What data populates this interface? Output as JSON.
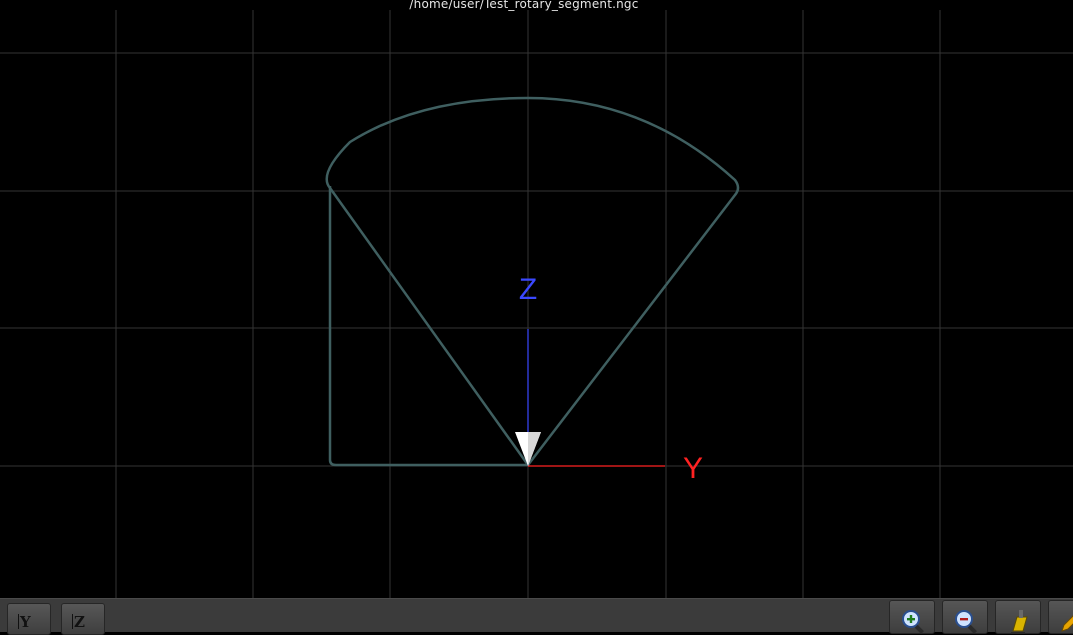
{
  "window": {
    "title": "/home/user/Test_rotary_segment.ngc"
  },
  "axes": {
    "z_label": "Z",
    "y_label": "Y"
  },
  "colors": {
    "background": "#000000",
    "grid": "#3a3a3a",
    "toolpath": "#3f5f60",
    "z_axis": "#3a48ff",
    "y_axis": "#ff2222",
    "tool_cone": "#ffffff",
    "toolbar": "#3b3b3b"
  },
  "toolbar": {
    "view_buttons": [
      {
        "label": "Y",
        "icon": "view-y-icon"
      },
      {
        "label": "Z",
        "icon": "view-z-icon"
      }
    ],
    "icon_buttons": [
      {
        "icon": "zoom-in-icon"
      },
      {
        "icon": "zoom-out-icon"
      },
      {
        "icon": "clear-plot-icon"
      },
      {
        "icon": "pencil-icon"
      }
    ]
  }
}
